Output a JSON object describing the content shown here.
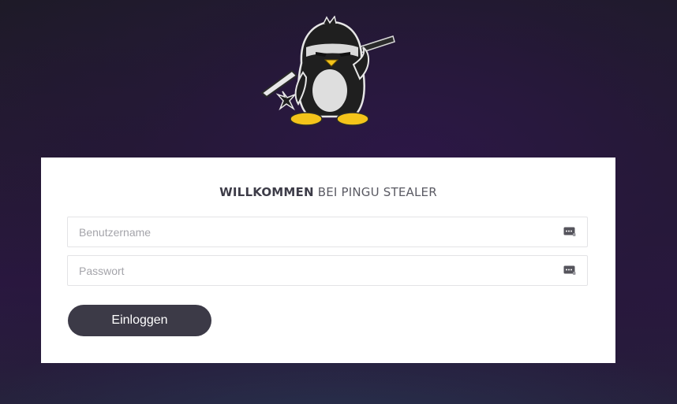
{
  "header": {
    "logo_icon": "ninja-penguin-icon"
  },
  "login": {
    "title_strong": "WILLKOMMEN",
    "title_rest": "BEI PINGU STEALER",
    "username": {
      "placeholder": "Benutzername",
      "value": "",
      "icon": "password-manager-key-icon"
    },
    "password": {
      "placeholder": "Passwort",
      "value": "",
      "icon": "password-manager-key-icon"
    },
    "submit_label": "Einloggen"
  },
  "colors": {
    "button_bg": "#3c3a47",
    "background_dark": "#1c1b24",
    "background_purple": "#2a1740"
  }
}
